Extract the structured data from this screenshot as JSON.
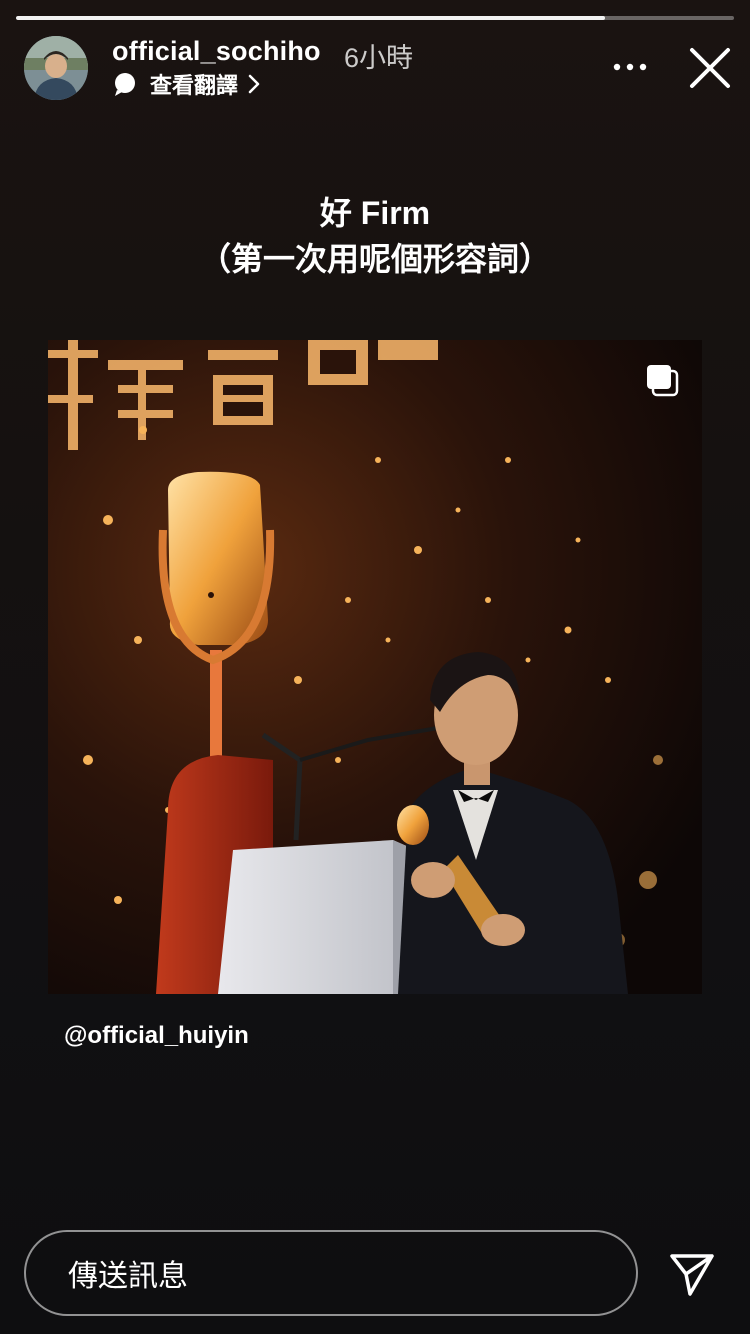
{
  "story": {
    "progress": 0.82,
    "username": "official_sochiho",
    "timestamp": "6小時",
    "translate_label": "查看翻譯",
    "caption_line1": "好 Firm",
    "caption_line2": "（第一次用呢個形容詞）",
    "mention": "@official_huiyin"
  },
  "reply": {
    "placeholder": "傳送訊息"
  },
  "icons": {
    "translate": "speech-bubble-icon",
    "chevron": "chevron-right-icon",
    "more": "more-horizontal-icon",
    "close": "close-icon",
    "multi_photo": "carousel-icon",
    "send": "send-icon"
  },
  "colors": {
    "background": "#151110",
    "text": "#ffffff",
    "progress_track": "rgba(255,255,255,0.35)",
    "progress_fill": "#f2f2f2",
    "gold_accent": "#e0a64a"
  }
}
